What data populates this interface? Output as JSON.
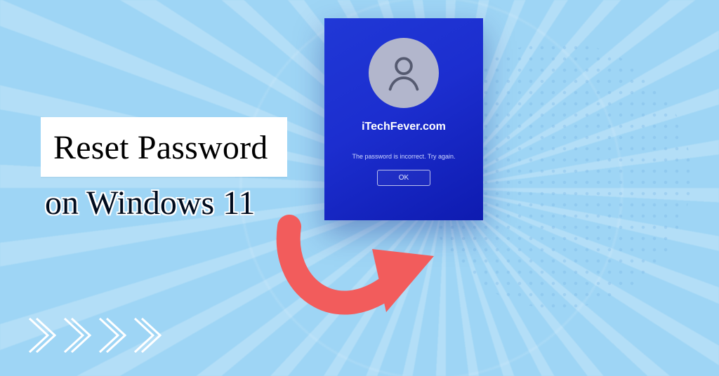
{
  "title": {
    "line1": "Reset Password",
    "line2": "on Windows 11"
  },
  "lockscreen": {
    "username": "iTechFever.com",
    "error": "The password is incorrect. Try again.",
    "ok_label": "OK"
  },
  "colors": {
    "bg": "#9ed5f5",
    "card_top": "#2038d6",
    "card_bottom": "#0e1bb0",
    "arrow": "#f25c5c",
    "chevron": "#ffffff"
  }
}
